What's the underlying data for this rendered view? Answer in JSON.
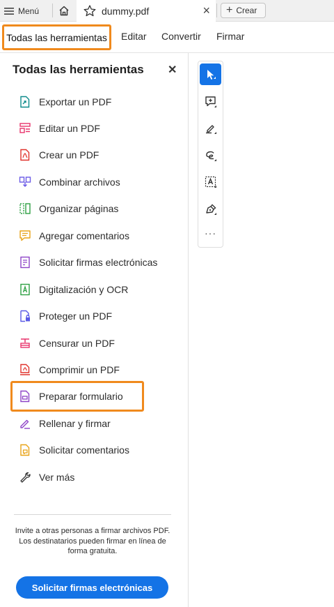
{
  "topbar": {
    "menu_label": "Menú",
    "tab_filename": "dummy.pdf",
    "create_label": "Crear"
  },
  "navbar": {
    "items": [
      "Todas las herramientas",
      "Editar",
      "Convertir",
      "Firmar"
    ]
  },
  "panel": {
    "title": "Todas las herramientas",
    "tools": [
      {
        "label": "Exportar un PDF",
        "icon": "export-pdf-icon",
        "color": "#0d8a8a"
      },
      {
        "label": "Editar un PDF",
        "icon": "edit-pdf-icon",
        "color": "#e8336b"
      },
      {
        "label": "Crear un PDF",
        "icon": "create-pdf-icon",
        "color": "#e0322c"
      },
      {
        "label": "Combinar archivos",
        "icon": "combine-files-icon",
        "color": "#6b5be6"
      },
      {
        "label": "Organizar páginas",
        "icon": "organize-pages-icon",
        "color": "#2ea043"
      },
      {
        "label": "Agregar comentarios",
        "icon": "add-comment-icon",
        "color": "#e8a317"
      },
      {
        "label": "Solicitar firmas electrónicas",
        "icon": "request-esign-icon",
        "color": "#8e44c7"
      },
      {
        "label": "Digitalización y OCR",
        "icon": "scan-ocr-icon",
        "color": "#2ea043"
      },
      {
        "label": "Proteger un PDF",
        "icon": "protect-pdf-icon",
        "color": "#5a5ae6"
      },
      {
        "label": "Censurar un PDF",
        "icon": "redact-pdf-icon",
        "color": "#e8336b"
      },
      {
        "label": "Comprimir un PDF",
        "icon": "compress-pdf-icon",
        "color": "#e0322c"
      },
      {
        "label": "Preparar formulario",
        "icon": "prepare-form-icon",
        "color": "#8e44c7"
      },
      {
        "label": "Rellenar y firmar",
        "icon": "fill-sign-icon",
        "color": "#8e44c7"
      },
      {
        "label": "Solicitar comentarios",
        "icon": "request-comments-icon",
        "color": "#e8a317"
      },
      {
        "label": "Ver más",
        "icon": "wrench-icon",
        "color": "#333333"
      }
    ],
    "invite_line1": "Invite a otras personas a firmar archivos PDF.",
    "invite_line2": "Los destinatarios pueden firmar en línea de forma gratuita.",
    "cta_label": "Solicitar firmas electrónicas"
  },
  "toolrail": {
    "tools": [
      "select-cursor-icon",
      "add-comment-icon",
      "highlight-pen-icon",
      "draw-lasso-icon",
      "text-select-icon",
      "sign-pen-icon"
    ],
    "more_label": "···"
  },
  "colors": {
    "accent": "#1473e6",
    "highlight": "#f08a1d"
  }
}
